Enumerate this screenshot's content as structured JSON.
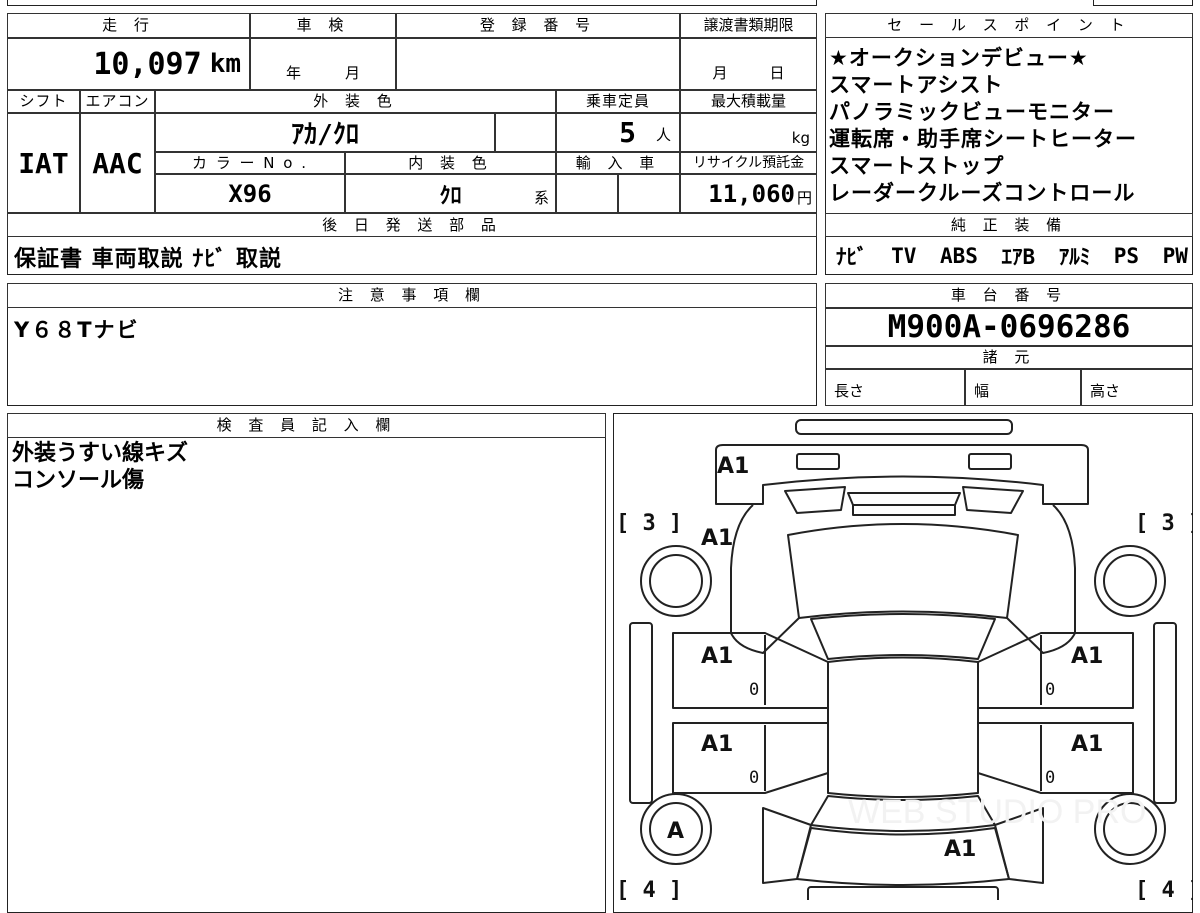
{
  "top": {
    "mileage_header": "走 行",
    "mileage": "10,097",
    "mileage_unit": "km",
    "inspection_header": "車 検",
    "inspection_year": "年",
    "inspection_month": "月",
    "registration_header": "登 録 番 号",
    "transfer_header": "譲渡書類期限",
    "transfer_month": "月",
    "transfer_day": "日"
  },
  "spec": {
    "shift_header": "シフト",
    "aircon_header": "エアコン",
    "exterior_header": "外 装 色",
    "capacity_header": "乗車定員",
    "maxload_header": "最大積載量",
    "shift": "IAT",
    "aircon": "AAC",
    "exterior_color": "ｱｶ/ｸﾛ",
    "capacity": "5",
    "capacity_unit": "人",
    "maxload_unit": "kg",
    "color_no_header": "カ ラ ー N o .",
    "interior_header": "内 装 色",
    "import_header": "輸 入 車",
    "recycle_header": "リサイクル預託金",
    "color_no": "X96",
    "interior_color": "ｸﾛ",
    "interior_suffix": "系",
    "recycle_fee": "11,060",
    "recycle_unit": "円"
  },
  "later_parts": {
    "header": "後 日 発 送 部 品",
    "value": "保証書 車両取説 ﾅﾋﾞ 取説"
  },
  "sales_points": {
    "header": "セ ー ル ス ポ イ ン ト",
    "items": [
      "★オークションデビュー★",
      "スマートアシスト",
      "パノラミックビューモニター",
      "運転席・助手席シートヒーター",
      "スマートストップ",
      "レーダークルーズコントロール"
    ]
  },
  "equipment": {
    "header": "純 正 装 備",
    "items": [
      "ﾅﾋﾞ",
      "TV",
      "ABS",
      "ｴｱB",
      "ｱﾙﾐ",
      "PS",
      "PW"
    ]
  },
  "notes": {
    "header": "注 意 事 項 欄",
    "value": "Y６８Tナビ"
  },
  "chassis": {
    "header": "車 台 番 号",
    "value": "M900A-0696286",
    "specs_header": "諸 元",
    "length": "長さ",
    "width": "幅",
    "height": "高さ"
  },
  "inspector": {
    "header": "検 査 員 記 入 欄",
    "lines": [
      "外装うすい線キズ",
      "コンソール傷"
    ]
  },
  "diagram": {
    "bracket_fl": "[ 3 ]",
    "bracket_fr": "[ 3 ]",
    "bracket_rl": "[ 4 ]",
    "bracket_rr": "[ 4 ]",
    "marks": {
      "front_bumper": "A1",
      "front_left_fender": "A1",
      "front_left_door": "A1",
      "rear_left_door": "A1",
      "front_right_door": "A1",
      "rear_right_door": "A1",
      "rear_left_wheel": "A",
      "rear_panel": "A1",
      "front_left_door_zero": "0",
      "rear_left_door_zero": "0",
      "front_right_door_zero": "0",
      "rear_right_door_zero": "0"
    },
    "watermark": "WEB STUDIO PRO"
  }
}
